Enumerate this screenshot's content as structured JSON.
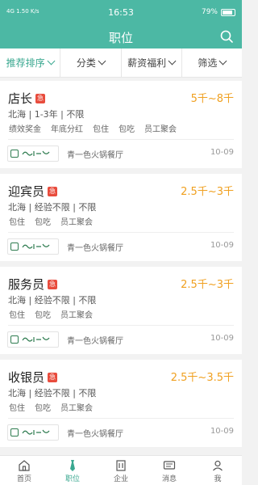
{
  "statusbar": {
    "left": "4G 1.50 K/s",
    "time": "16:53",
    "battery": "79%"
  },
  "header": {
    "title": "职位"
  },
  "filters": [
    {
      "label": "推荐排序",
      "active": true
    },
    {
      "label": "分类",
      "active": false
    },
    {
      "label": "薪资福利",
      "active": false
    },
    {
      "label": "筛选",
      "active": false
    }
  ],
  "jobs": [
    {
      "title": "店长",
      "urgent": "急",
      "salary": "5千~8千",
      "meta": "北海 | 1-3年 | 不限",
      "tags": [
        "绩效奖金",
        "年底分红",
        "包住",
        "包吃",
        "员工聚会"
      ],
      "company": "青一色火锅餐厅",
      "date": "10-09"
    },
    {
      "title": "迎宾员",
      "urgent": "急",
      "salary": "2.5千~3千",
      "meta": "北海 | 经验不限 | 不限",
      "tags": [
        "包住",
        "包吃",
        "员工聚会"
      ],
      "company": "青一色火锅餐厅",
      "date": "10-09"
    },
    {
      "title": "服务员",
      "urgent": "急",
      "salary": "2.5千~3千",
      "meta": "北海 | 经验不限 | 不限",
      "tags": [
        "包住",
        "包吃",
        "员工聚会"
      ],
      "company": "青一色火锅餐厅",
      "date": "10-09"
    },
    {
      "title": "收银员",
      "urgent": "急",
      "salary": "2.5千~3.5千",
      "meta": "北海 | 经验不限 | 不限",
      "tags": [
        "包住",
        "包吃",
        "员工聚会"
      ],
      "company": "青一色火锅餐厅",
      "date": "10-09"
    }
  ],
  "tabbar": [
    {
      "label": "首页",
      "icon": "home-icon",
      "active": false
    },
    {
      "label": "职位",
      "icon": "tie-icon",
      "active": true
    },
    {
      "label": "企业",
      "icon": "building-icon",
      "active": false
    },
    {
      "label": "消息",
      "icon": "message-icon",
      "active": false
    },
    {
      "label": "我",
      "icon": "person-icon",
      "active": false
    }
  ],
  "colors": {
    "brand": "#4cb8a4",
    "accent": "#3aa890",
    "salary": "#f0a020",
    "urgent": "#e84c3d"
  }
}
